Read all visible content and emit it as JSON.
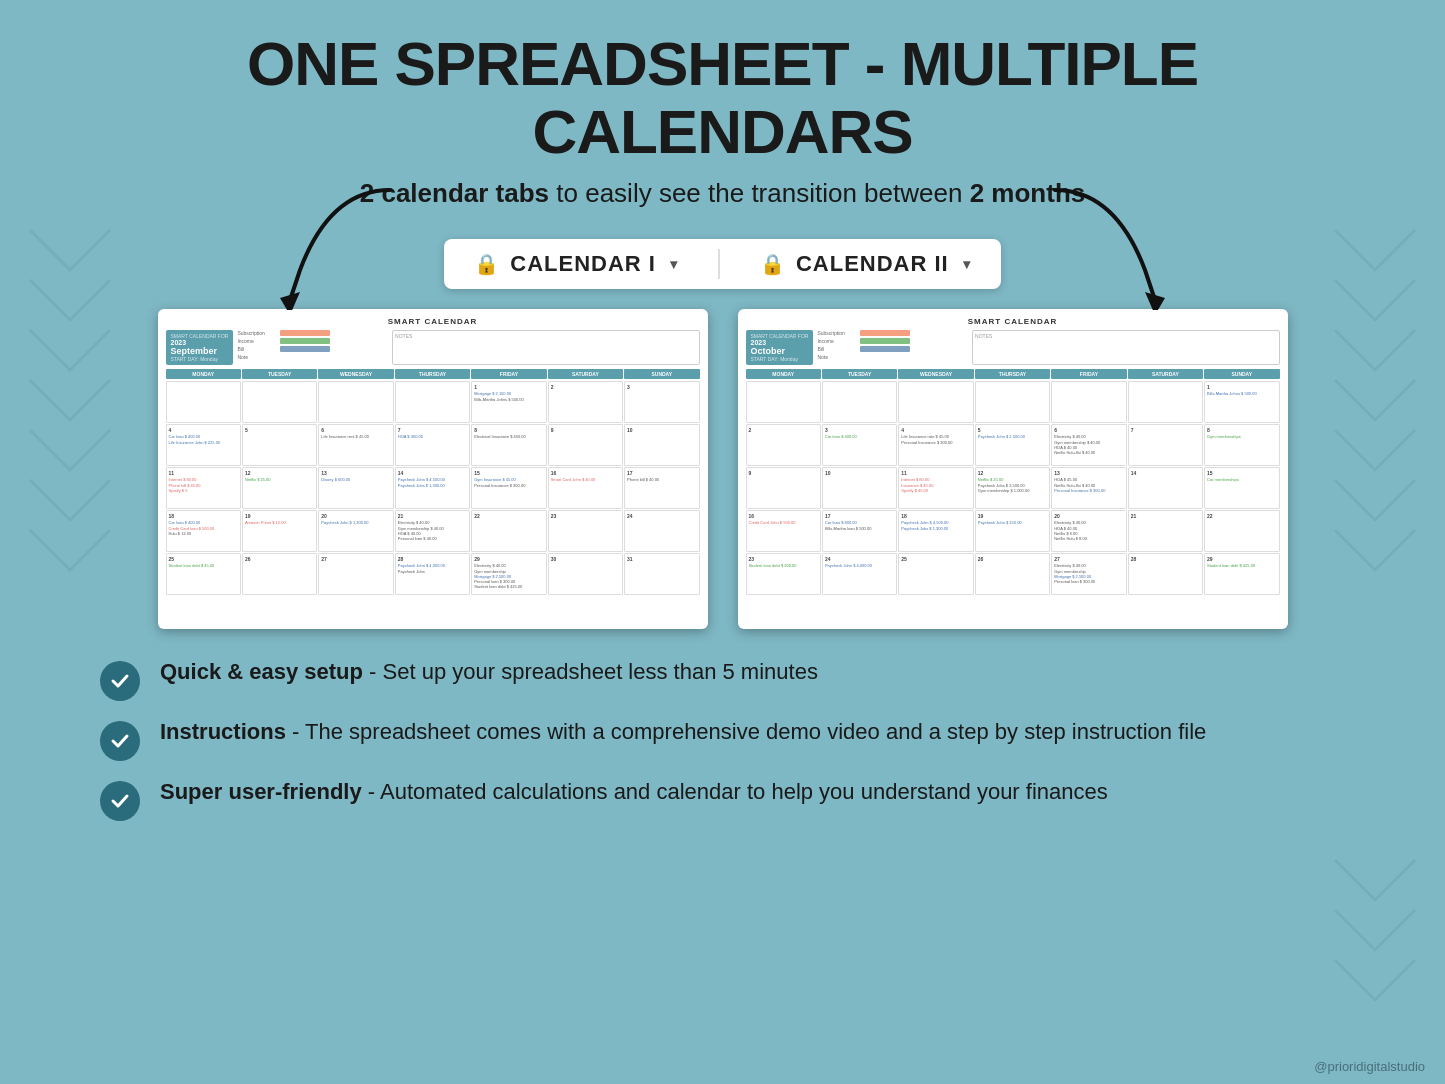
{
  "header": {
    "title": "ONE SPREADSHEET - MULTIPLE CALENDARS",
    "subtitle_part1": "2 calendar tabs",
    "subtitle_middle": " to easily see the transition between ",
    "subtitle_part2": "2 months"
  },
  "tabs": {
    "tab1_label": "CALENDAR I",
    "tab2_label": "CALENDAR II",
    "tab1_icon": "🔒",
    "tab2_icon": "🔒"
  },
  "calendars": [
    {
      "title": "SMART CALENDAR",
      "year": "2023",
      "month": "September",
      "start_day": "Monday"
    },
    {
      "title": "SMART CALENDAR",
      "year": "2023",
      "month": "October",
      "start_day": "Monday"
    }
  ],
  "features": [
    {
      "bold": "Quick & easy setup",
      "text": " - Set up your spreadsheet less than 5 minutes"
    },
    {
      "bold": "Instructions",
      "text": " - The spreadsheet comes with a comprehensive demo video and a step by step instruction file"
    },
    {
      "bold": "Super user-friendly",
      "text": " - Automated calculations and calendar to help you understand your finances"
    }
  ],
  "watermark": "@prioridigitalstudio"
}
